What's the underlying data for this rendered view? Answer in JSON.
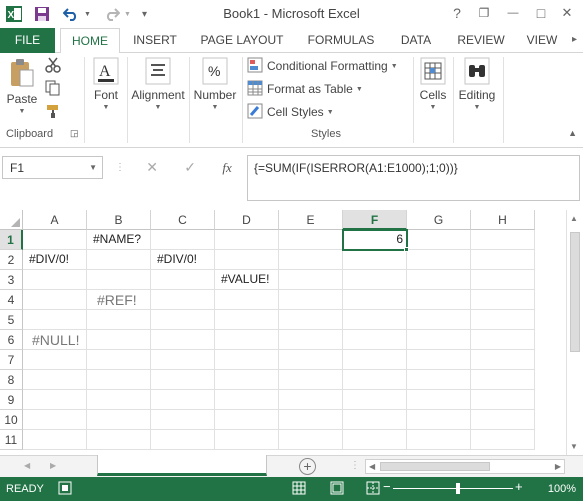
{
  "window": {
    "title": "Book1 - Microsoft Excel"
  },
  "quick_access": {
    "icons": [
      "excel-logo-icon",
      "save-icon",
      "undo-icon",
      "redo-icon",
      "customize-icon"
    ]
  },
  "window_controls": {
    "help": "?",
    "restore": "❐",
    "minimize": "—",
    "maximize": "□",
    "close": "✕"
  },
  "tabs": [
    "FILE",
    "HOME",
    "INSERT",
    "PAGE LAYOUT",
    "FORMULAS",
    "DATA",
    "REVIEW",
    "VIEW"
  ],
  "ribbon": {
    "clipboard": {
      "paste_label": "Paste",
      "group_label": "Clipboard"
    },
    "font_label": "Font",
    "alignment_label": "Alignment",
    "number_label": "Number",
    "styles": {
      "conditional_formatting": "Conditional Formatting",
      "format_as_table": "Format as Table",
      "cell_styles": "Cell Styles",
      "group_label": "Styles"
    },
    "cells_label": "Cells",
    "editing_label": "Editing"
  },
  "formula_bar": {
    "name_box": "F1",
    "fx": "fx",
    "formula": "{=SUM(IF(ISERROR(A1:E1000);1;0))}"
  },
  "grid": {
    "columns": [
      "A",
      "B",
      "C",
      "D",
      "E",
      "F",
      "G",
      "H"
    ],
    "rows": [
      "1",
      "2",
      "3",
      "4",
      "5",
      "6",
      "7",
      "8",
      "9",
      "10",
      "11"
    ],
    "active_column": "F",
    "active_row": "1",
    "cells": {
      "B1": "#NAME?",
      "F1": "6",
      "A2": "#DIV/0!",
      "C2": "#DIV/0!",
      "D3": "#VALUE!",
      "B4": "#REF!",
      "A6": "#NULL!"
    }
  },
  "status": {
    "ready": "READY",
    "zoom": "100%"
  },
  "colors": {
    "accent": "#217346"
  }
}
